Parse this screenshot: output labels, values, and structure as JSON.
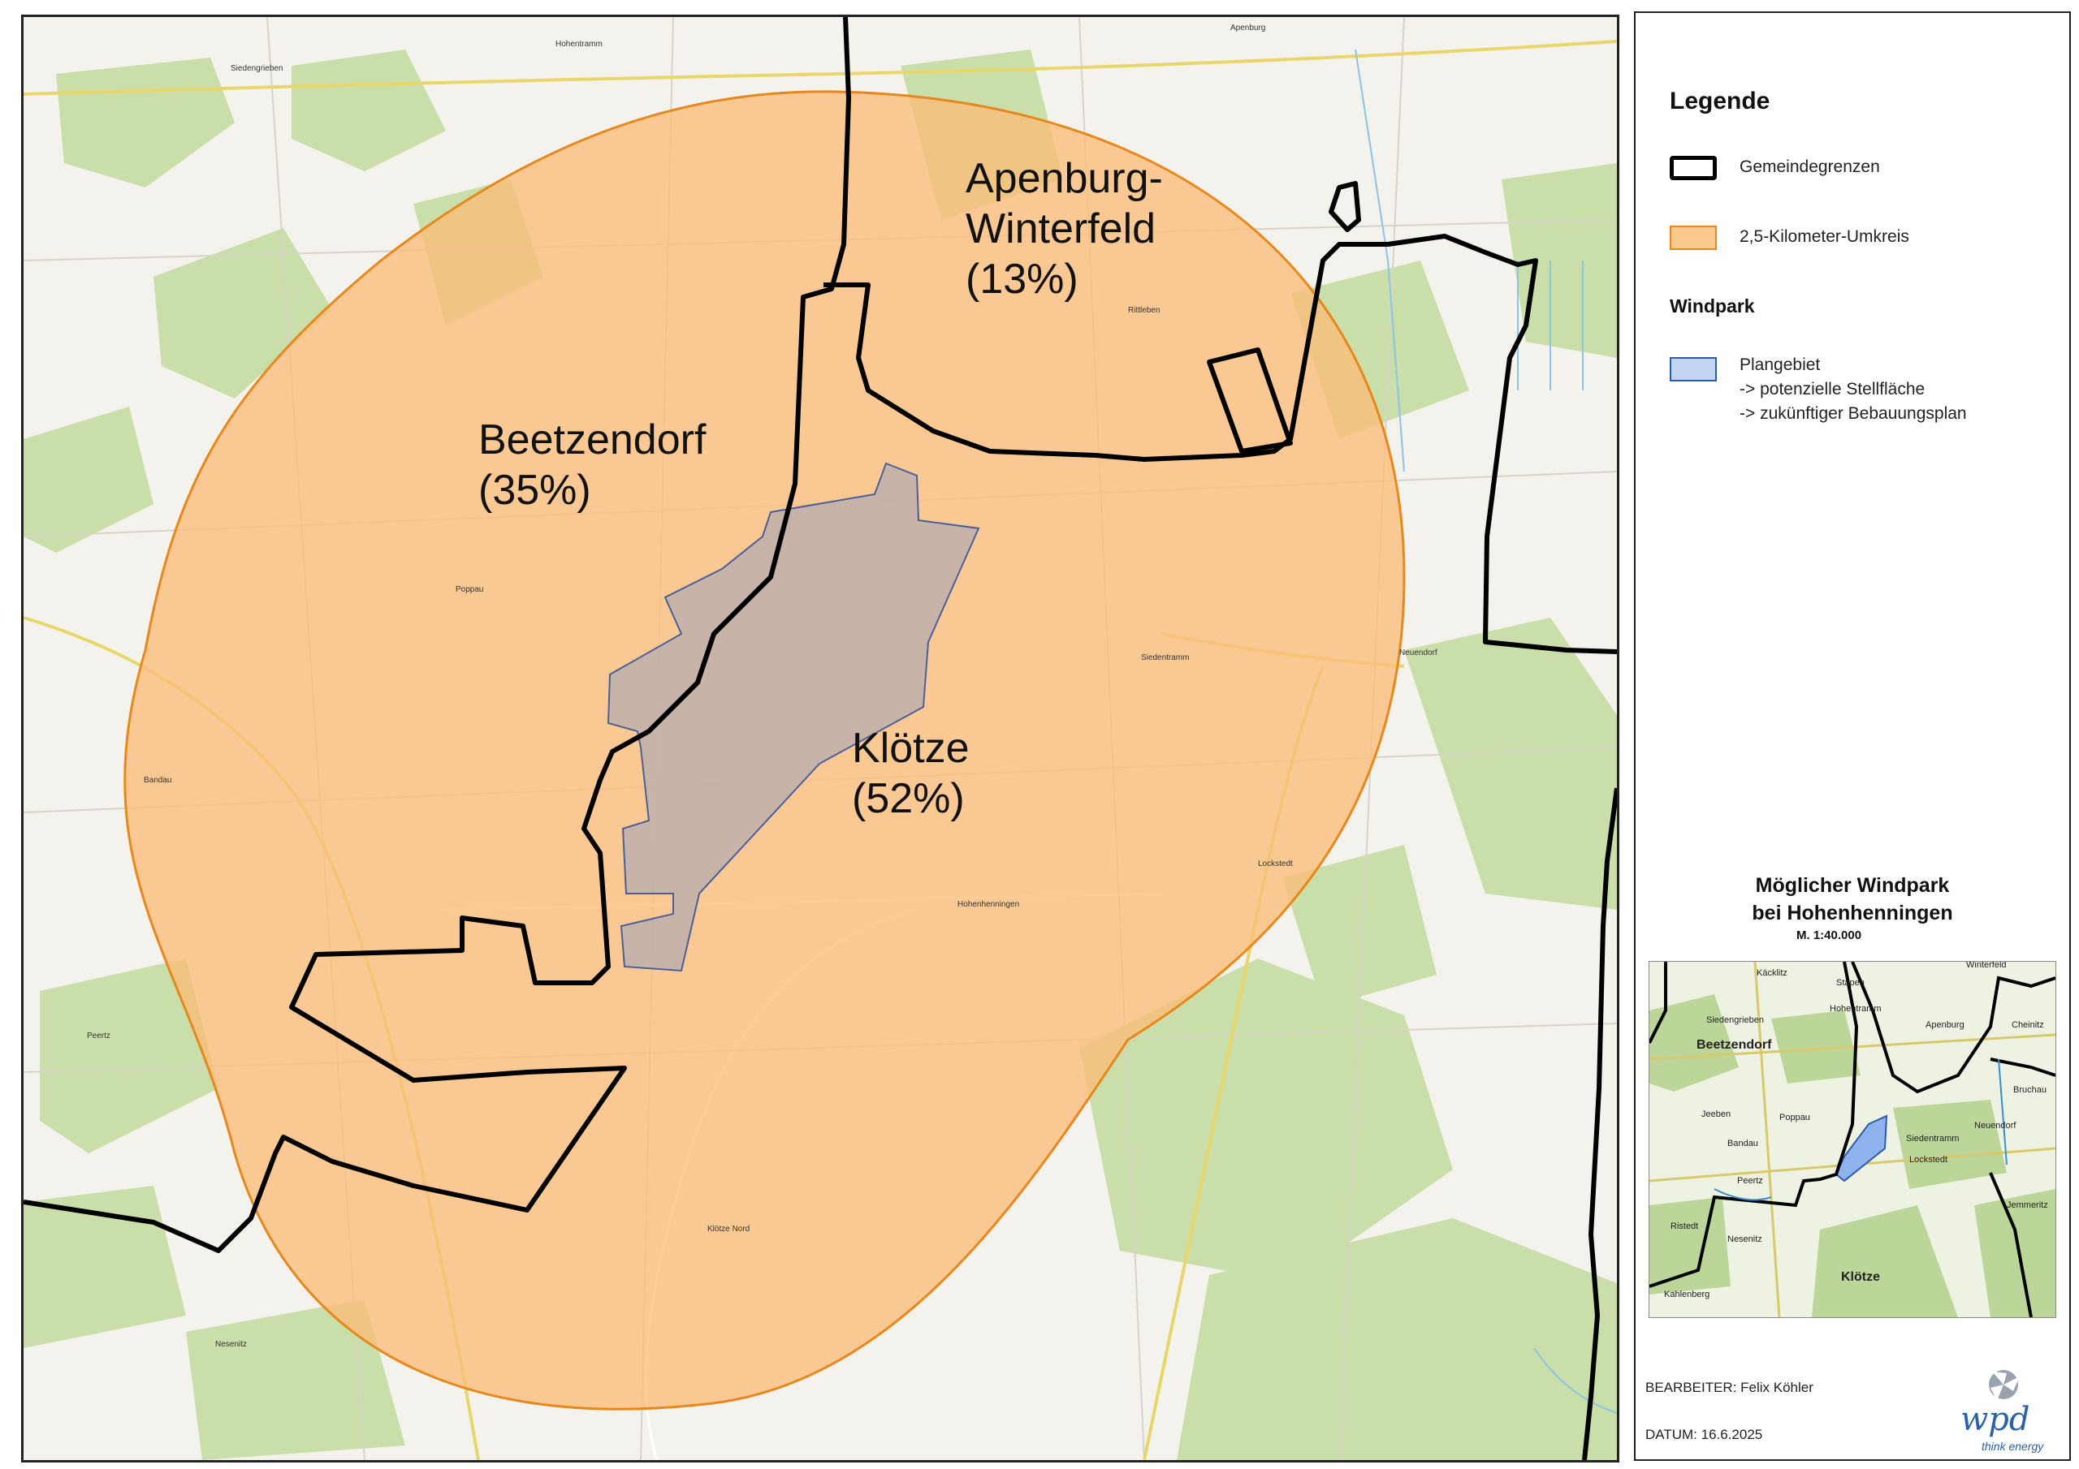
{
  "map": {
    "areas": [
      {
        "name": "Apenburg-Winterfeld",
        "line1": "Apenburg-",
        "line2": "Winterfeld",
        "share": "(13%)"
      },
      {
        "name": "Beetzendorf",
        "line1": "Beetzendorf",
        "share": "(35%)"
      },
      {
        "name": "Klötze",
        "line1": "Klötze",
        "share": "(52%)"
      }
    ],
    "places": [
      "Hohentramm",
      "Siedengrieben",
      "Apenburg",
      "Rittleben",
      "Poppau",
      "Siedentramm",
      "Neuendorf",
      "Bandau",
      "Hohenhenningen",
      "Lockstedt",
      "Peertz",
      "Klötze Nord",
      "Nesenitz"
    ],
    "colors": {
      "circle_fill": "#fbbe7a",
      "circle_stroke": "#e8881c",
      "boundary": "#000000",
      "plan_area": "#c8b3a6",
      "forest": "#c9dea8"
    }
  },
  "legend": {
    "title": "Legende",
    "items": [
      {
        "label": "Gemeindegrenzen",
        "swatch": "boundary"
      },
      {
        "label": "2,5-Kilometer-Umkreis",
        "swatch": "circle"
      }
    ],
    "windpark": {
      "title": "Windpark",
      "label_lines": [
        "Plangebiet",
        "-> potenzielle Stellfläche",
        "-> zukünftiger Bebauungsplan"
      ]
    }
  },
  "map_title": {
    "line1": "Möglicher Windpark",
    "line2": "bei Hohenhenningen",
    "scale": "M.  1:40.000"
  },
  "overview": {
    "labels": [
      "Winterfeld",
      "Käcklitz",
      "Stapen",
      "Siedengrieben",
      "Hohentramm",
      "Apenburg",
      "Beetzendorf",
      "Cheinitz",
      "Bruchau",
      "Jeeben",
      "Poppau",
      "Siedentramm",
      "Neuendorf",
      "Bandau",
      "Lockstedt",
      "Peertz",
      "Jemmeritz",
      "Ristedt",
      "Nesenitz",
      "Kahlenberg",
      "Klötze"
    ]
  },
  "meta": {
    "bearbeiter": "BEARBEITER: Felix Köhler",
    "datum": "DATUM: 16.6.2025"
  },
  "logo": {
    "text": "wpd",
    "tagline": "think energy",
    "color": "#2b5fa8"
  }
}
